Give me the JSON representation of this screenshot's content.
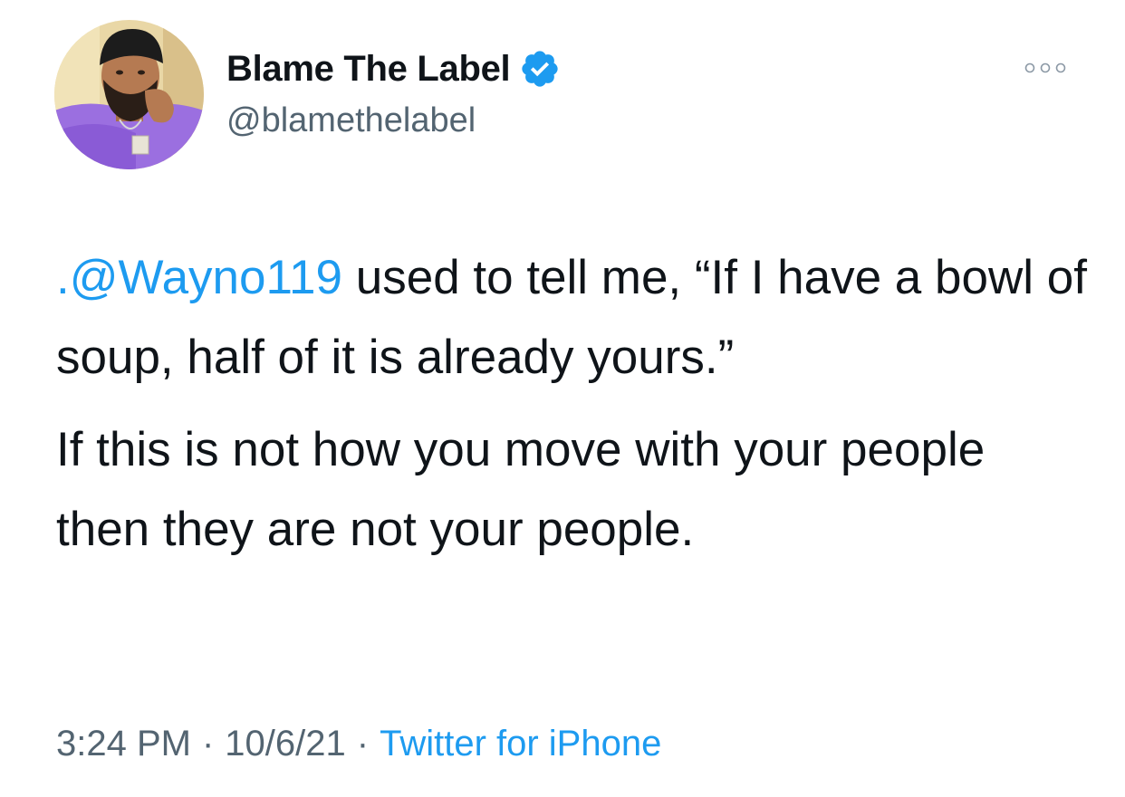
{
  "tweet": {
    "author": {
      "display_name": "Blame The Label",
      "handle": "@blamethelabel",
      "verified": true,
      "avatar_icon": "profile-photo"
    },
    "more_icon": "ellipsis-icon",
    "body": {
      "mention": ".@Wayno119",
      "paragraph1_rest": " used to tell me, “If I have a bowl of soup, half of it is already yours.”",
      "paragraph2": "If this is not how you move with your people then they are not your people."
    },
    "meta": {
      "time": "3:24 PM",
      "separator": "·",
      "date": "10/6/21",
      "source": "Twitter for iPhone"
    },
    "colors": {
      "text": "#0f1419",
      "secondary": "#536471",
      "accent": "#1d9bf0"
    }
  }
}
